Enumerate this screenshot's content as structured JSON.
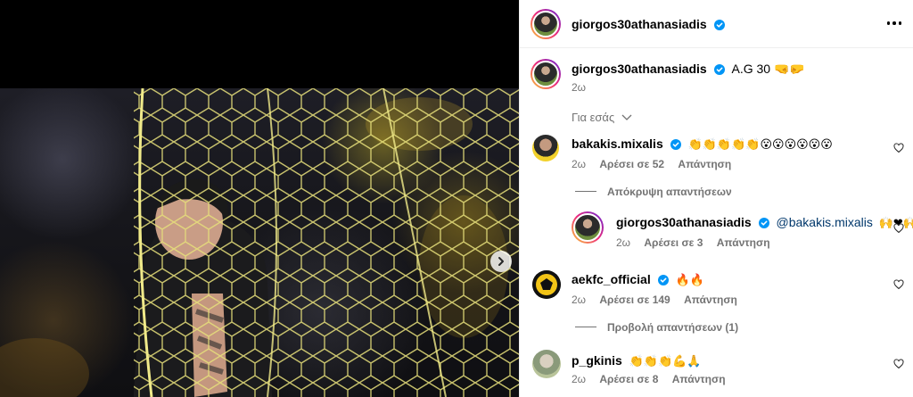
{
  "post": {
    "author": "giorgos30athanasiadis",
    "caption": "A.G 30 🤜🤛",
    "time": "2ω"
  },
  "colors": {
    "verified": "#0095f6",
    "muted": "#737373",
    "mention": "#00376b"
  },
  "filter_label": "Για εσάς",
  "comments": [
    {
      "username": "bakakis.mixalis",
      "text": "👏👏👏👏👏😮😮😮😮😮😮",
      "time": "2ω",
      "likes": "Αρέσει σε 52",
      "reply": "Απάντηση",
      "thread_toggle": "Απόκρυψη απαντήσεων"
    },
    {
      "username": "aekfc_official",
      "text": "🔥🔥",
      "time": "2ω",
      "likes": "Αρέσει σε 149",
      "reply": "Απάντηση",
      "thread_toggle": "Προβολή απαντήσεων (1)"
    },
    {
      "username": "p_gkinis",
      "text": "👏👏👏💪🙏",
      "time": "2ω",
      "likes": "Αρέσει σε 8",
      "reply": "Απάντηση"
    }
  ],
  "reply": {
    "username": "giorgos30athanasiadis",
    "mention": "@bakakis.mixalis",
    "text": "🙌❤🙌",
    "time": "2ω",
    "likes": "Αρέσει σε 3",
    "reply": "Απάντηση"
  }
}
